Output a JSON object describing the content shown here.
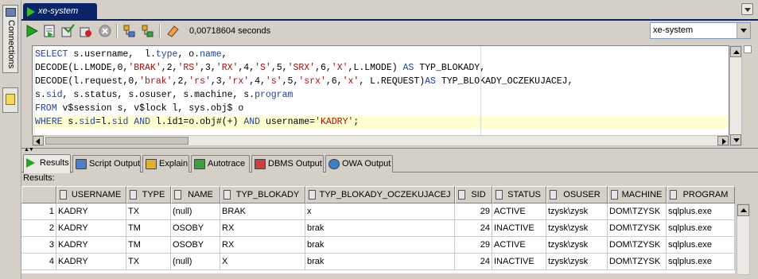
{
  "left_strip": {
    "connections_label": "Connections"
  },
  "document_tab": {
    "label": "xe-system"
  },
  "toolbar": {
    "elapsed_time": "0,00718604 seconds",
    "connection": "xe-system",
    "buttons": [
      "run-statement",
      "run-script",
      "commit",
      "rollback",
      "cancel",
      "explain-plan",
      "autotrace",
      "clear"
    ]
  },
  "editor": {
    "lines": [
      [
        {
          "k": "kw",
          "t": "SELECT"
        },
        {
          "k": "fn",
          "t": " s.username,  l."
        },
        {
          "k": "kw",
          "t": "type"
        },
        {
          "k": "fn",
          "t": ", o."
        },
        {
          "k": "kw",
          "t": "name"
        },
        {
          "k": "fn",
          "t": ","
        }
      ],
      [
        {
          "k": "fn",
          "t": "DECODE(L.LMODE,0,"
        },
        {
          "k": "str",
          "t": "'BRAK'"
        },
        {
          "k": "fn",
          "t": ",2,"
        },
        {
          "k": "str",
          "t": "'RS'"
        },
        {
          "k": "fn",
          "t": ",3,"
        },
        {
          "k": "str",
          "t": "'RX'"
        },
        {
          "k": "fn",
          "t": ",4,"
        },
        {
          "k": "str",
          "t": "'S'"
        },
        {
          "k": "fn",
          "t": ",5,"
        },
        {
          "k": "str",
          "t": "'SRX'"
        },
        {
          "k": "fn",
          "t": ",6,"
        },
        {
          "k": "str",
          "t": "'X'"
        },
        {
          "k": "fn",
          "t": ",L.LMODE) "
        },
        {
          "k": "kw",
          "t": "AS"
        },
        {
          "k": "fn",
          "t": " TYP_BLOKADY,"
        }
      ],
      [
        {
          "k": "fn",
          "t": "DECODE(l.request,0,"
        },
        {
          "k": "str",
          "t": "'brak'"
        },
        {
          "k": "fn",
          "t": ",2,"
        },
        {
          "k": "str",
          "t": "'rs'"
        },
        {
          "k": "fn",
          "t": ",3,"
        },
        {
          "k": "str",
          "t": "'rx'"
        },
        {
          "k": "fn",
          "t": ",4,"
        },
        {
          "k": "str",
          "t": "'s'"
        },
        {
          "k": "fn",
          "t": ",5,"
        },
        {
          "k": "str",
          "t": "'srx'"
        },
        {
          "k": "fn",
          "t": ",6,"
        },
        {
          "k": "str",
          "t": "'x'"
        },
        {
          "k": "fn",
          "t": ", L.REQUEST)"
        },
        {
          "k": "kw",
          "t": "AS"
        },
        {
          "k": "fn",
          "t": " TYP_BLOKADY_OCZEKUJACEJ,"
        }
      ],
      [
        {
          "k": "fn",
          "t": "s."
        },
        {
          "k": "kw",
          "t": "sid"
        },
        {
          "k": "fn",
          "t": ", s.status, s.osuser, s.machine, s."
        },
        {
          "k": "kw",
          "t": "program"
        }
      ],
      [
        {
          "k": "kw",
          "t": "FROM"
        },
        {
          "k": "fn",
          "t": " v$session s, v$lock l, sys.obj$ o"
        }
      ],
      [
        {
          "k": "kw",
          "t": "WHERE"
        },
        {
          "k": "fn",
          "t": " s."
        },
        {
          "k": "kw",
          "t": "sid"
        },
        {
          "k": "fn",
          "t": "=l."
        },
        {
          "k": "kw",
          "t": "sid"
        },
        {
          "k": "fn",
          "t": " "
        },
        {
          "k": "kw",
          "t": "AND"
        },
        {
          "k": "fn",
          "t": " l.id1=o.obj#(+) "
        },
        {
          "k": "kw",
          "t": "AND"
        },
        {
          "k": "fn",
          "t": " username="
        },
        {
          "k": "str",
          "t": "'KADRY'"
        },
        {
          "k": "fn",
          "t": ";"
        }
      ]
    ],
    "current_line": 5
  },
  "result_tabs": [
    {
      "label": "Results",
      "icon": "run-icon",
      "active": true
    },
    {
      "label": "Script Output",
      "icon": "script-icon",
      "active": false
    },
    {
      "label": "Explain",
      "icon": "explain-icon",
      "active": false
    },
    {
      "label": "Autotrace",
      "icon": "autotrace-icon",
      "active": false
    },
    {
      "label": "DBMS Output",
      "icon": "dbms-icon",
      "active": false
    },
    {
      "label": "OWA Output",
      "icon": "owa-icon",
      "active": false
    }
  ],
  "results": {
    "label": "Results:",
    "columns": [
      "USERNAME",
      "TYPE",
      "NAME",
      "TYP_BLOKADY",
      "TYP_BLOKADY_OCZEKUJACEJ",
      "SID",
      "STATUS",
      "OSUSER",
      "MACHINE",
      "PROGRAM"
    ],
    "rows": [
      [
        "1",
        "KADRY",
        "TX",
        "(null)",
        "BRAK",
        "x",
        "29",
        "ACTIVE",
        "tzysk\\zysk",
        "DOM\\TZYSK",
        "sqlplus.exe"
      ],
      [
        "2",
        "KADRY",
        "TM",
        "OSOBY",
        "RX",
        "brak",
        "24",
        "INACTIVE",
        "tzysk\\zysk",
        "DOM\\TZYSK",
        "sqlplus.exe"
      ],
      [
        "3",
        "KADRY",
        "TM",
        "OSOBY",
        "RX",
        "brak",
        "29",
        "ACTIVE",
        "tzysk\\zysk",
        "DOM\\TZYSK",
        "sqlplus.exe"
      ],
      [
        "4",
        "KADRY",
        "TX",
        "(null)",
        "X",
        "brak",
        "24",
        "INACTIVE",
        "tzysk\\zysk",
        "DOM\\TZYSK",
        "sqlplus.exe"
      ]
    ]
  }
}
